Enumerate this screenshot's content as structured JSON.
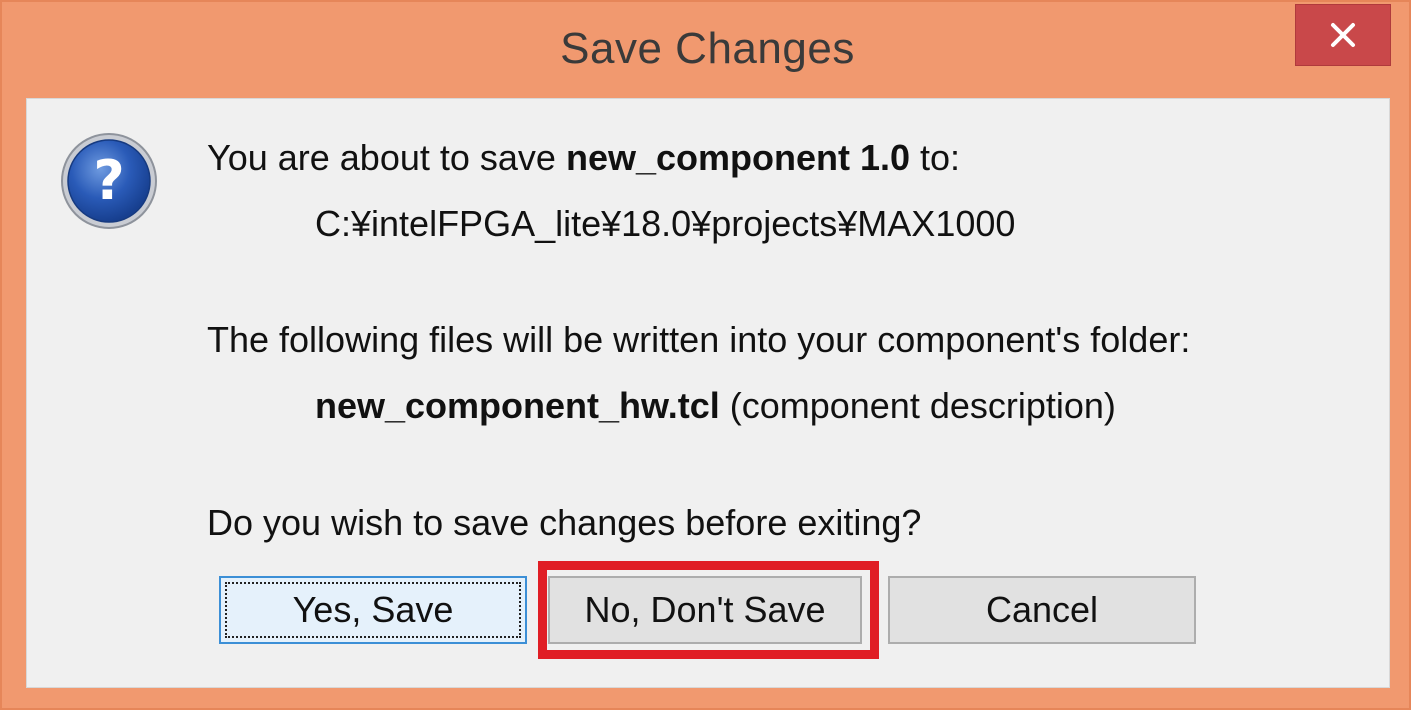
{
  "window": {
    "title": "Save Changes",
    "close_label": "×"
  },
  "message": {
    "line1_prefix": "You are about to save ",
    "line1_component": "new_component 1.0",
    "line1_suffix": " to:",
    "path": "C:¥intelFPGA_lite¥18.0¥projects¥MAX1000",
    "files_intro": "The following files will be written into your component's folder:",
    "file_name": "new_component_hw.tcl",
    "file_desc": " (component description)",
    "question": "Do you wish to save changes before exiting?"
  },
  "buttons": {
    "yes": "Yes, Save",
    "no": "No, Don't Save",
    "cancel": "Cancel"
  },
  "icon": {
    "name": "question-icon",
    "glyph": "?"
  },
  "colors": {
    "frame": "#f1996f",
    "close_button": "#c9484a",
    "highlight": "#e01e25",
    "icon_blue": "#1f4aa0"
  }
}
